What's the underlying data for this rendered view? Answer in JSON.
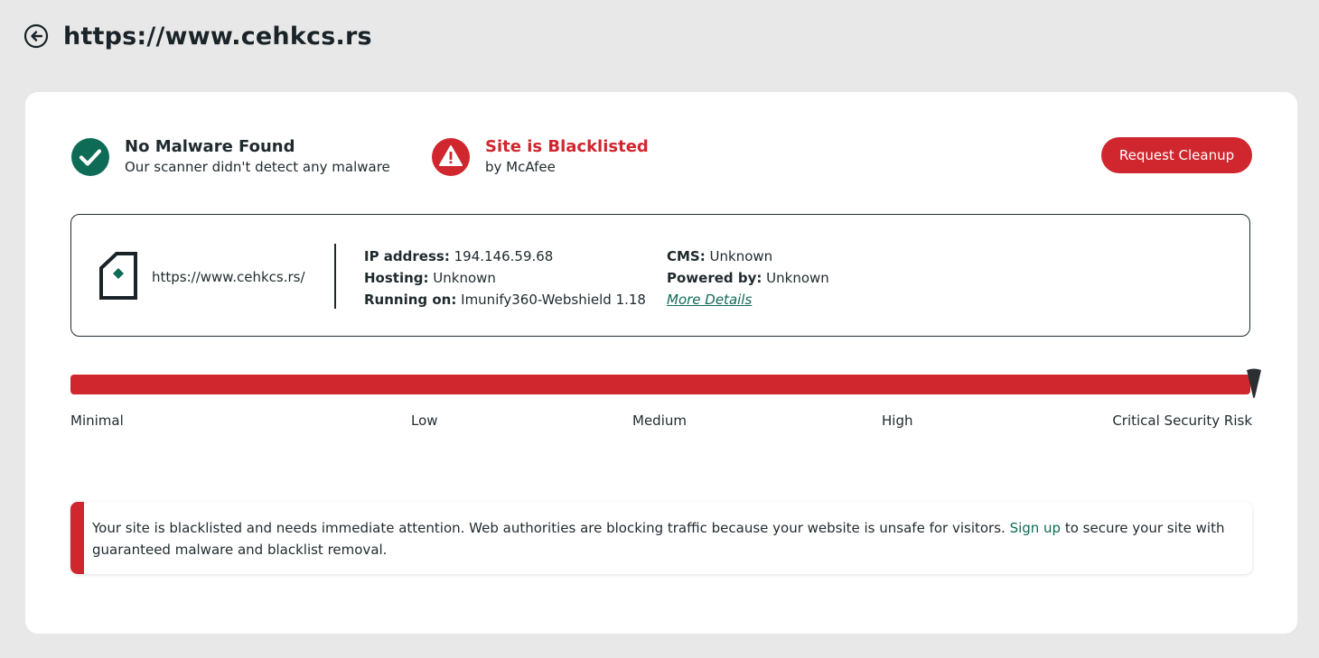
{
  "header": {
    "title": "https://www.cehkcs.rs",
    "back_icon": "arrow-left-circle-icon"
  },
  "status": {
    "malware": {
      "title": "No Malware Found",
      "subtitle": "Our scanner didn't detect any malware",
      "icon": "check-circle-icon",
      "color": "#0e6b56"
    },
    "blacklist": {
      "title": "Site is Blacklisted",
      "subtitle": "by McAfee",
      "icon": "warning-circle-icon",
      "color": "#d0262e"
    }
  },
  "actions": {
    "cleanup_label": "Request Cleanup"
  },
  "site_info": {
    "url": "https://www.cehkcs.rs/",
    "ip_label": "IP address:",
    "ip_value": "194.146.59.68",
    "hosting_label": "Hosting:",
    "hosting_value": "Unknown",
    "running_label": "Running on:",
    "running_value": "Imunify360-Webshield 1.18",
    "cms_label": "CMS:",
    "cms_value": "Unknown",
    "powered_label": "Powered by:",
    "powered_value": "Unknown",
    "more_details": "More Details"
  },
  "risk": {
    "level": "Critical Security Risk",
    "fill_fraction": 1.0,
    "labels": [
      "Minimal",
      "Low",
      "Medium",
      "High",
      "Critical Security Risk"
    ],
    "color": "#d0262e"
  },
  "alert": {
    "text_before": "Your site is blacklisted and needs immediate attention. Web authorities are blocking traffic because your website is unsafe for visitors. ",
    "link": "Sign up",
    "text_after": " to secure your site with guaranteed malware and blacklist removal."
  }
}
